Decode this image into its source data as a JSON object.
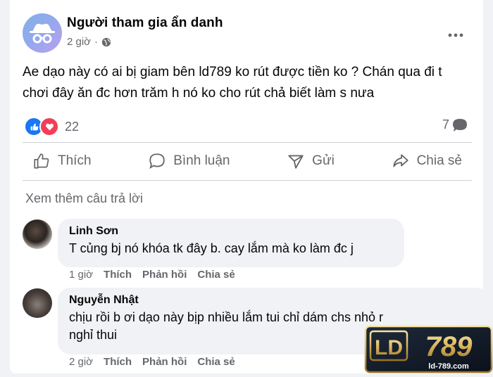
{
  "post": {
    "author": "Người tham gia ẩn danh",
    "time": "2 giờ",
    "separator": "·",
    "text_line1": "Ae dạo này có ai bị giam bên ld789 ko rút được tiền ko ? Chán qua đi t",
    "text_line2": "chơi đây ăn đc hơn trăm h nó ko cho rút chả biết làm s nưa",
    "reaction_count": "22",
    "comment_count": "7"
  },
  "actions": {
    "like": "Thích",
    "comment": "Bình luận",
    "send": "Gửi",
    "share": "Chia sẻ"
  },
  "see_more": "Xem thêm câu trả lời",
  "comments": [
    {
      "name": "Linh Sơn",
      "text": "T củng bj nó khóa tk đây b. cay lắm mà ko làm đc j",
      "time": "1 giờ",
      "like": "Thích",
      "reply": "Phản hồi",
      "share": "Chia sẻ"
    },
    {
      "name": "Nguyễn Nhật",
      "text_line1": "chịu rồi b ơi dạo này bịp nhiều lắm tui chỉ dám chs nhỏ r",
      "text_line2": "nghỉ thui",
      "time": "2 giờ",
      "like": "Thích",
      "reply": "Phản hồi",
      "share": "Chia sẻ"
    }
  ],
  "logo": {
    "big": "LD789",
    "domain": "ld-789.com"
  },
  "colors": {
    "like_blue": "#1877f2",
    "love_red": "#f33e58",
    "muted": "#65676b",
    "logo_gold": "#d8b25a"
  },
  "icons": [
    "incognito-icon",
    "globe-icon",
    "more-icon",
    "like-reaction-icon",
    "love-reaction-icon",
    "comment-bubble-icon",
    "thumb-up-icon",
    "comment-icon",
    "send-icon",
    "share-icon"
  ]
}
